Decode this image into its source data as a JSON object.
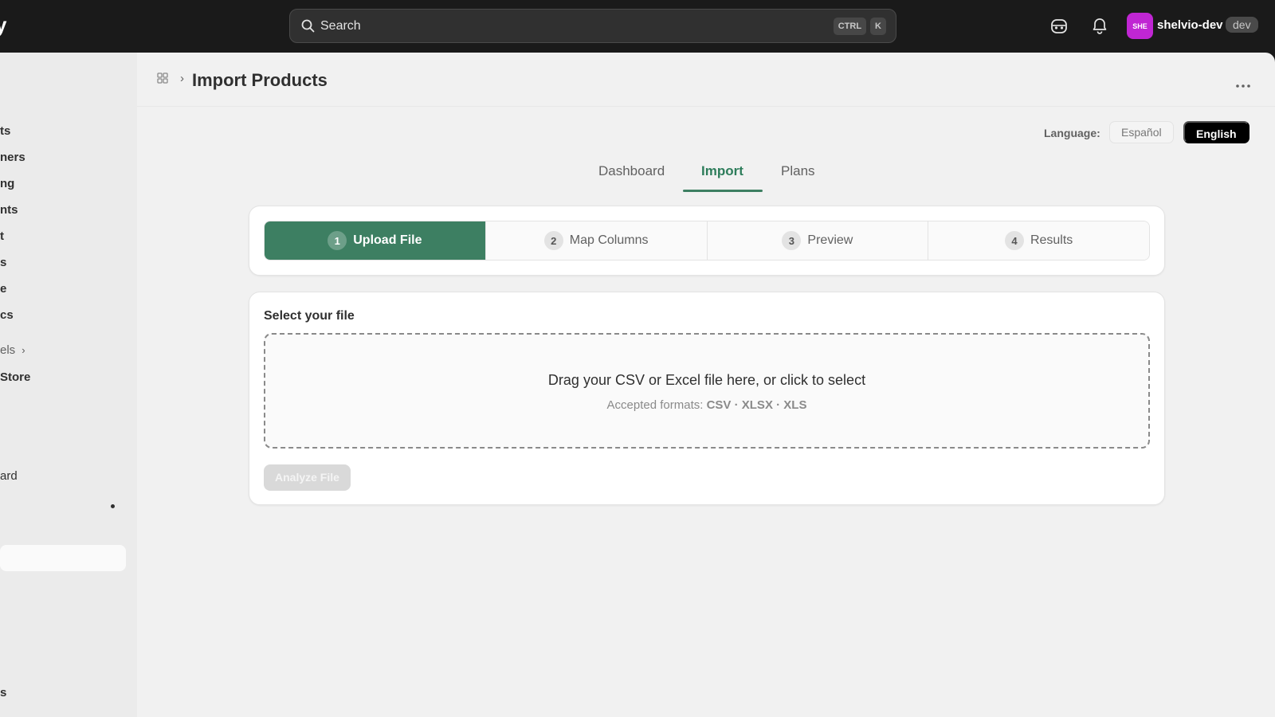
{
  "topbar": {
    "brand": "y",
    "search_placeholder": "Search",
    "kbd1": "CTRL",
    "kbd2": "K",
    "avatar_initials": "SHE",
    "store_name": "shelvio-dev",
    "store_badge": "dev"
  },
  "sidebar": {
    "items": [
      "ts",
      "ners",
      "ng",
      "nts",
      "t",
      "s",
      "e",
      "cs"
    ],
    "channels_label": "els",
    "store_label": "Store",
    "app_items": [
      "ard"
    ],
    "bottom_item": "s"
  },
  "header": {
    "title": "Import Products"
  },
  "language": {
    "label": "Language:",
    "option_es": "Español",
    "option_en": "English",
    "selected": "English"
  },
  "tabs": [
    {
      "label": "Dashboard"
    },
    {
      "label": "Import"
    },
    {
      "label": "Plans"
    }
  ],
  "steps": [
    {
      "num": "1",
      "label": "Upload File"
    },
    {
      "num": "2",
      "label": "Map Columns"
    },
    {
      "num": "3",
      "label": "Preview"
    },
    {
      "num": "4",
      "label": "Results"
    }
  ],
  "upload": {
    "label": "Select your file",
    "dropzone_title": "Drag your CSV or Excel file here, or click to select",
    "formats_prefix": "Accepted formats:",
    "formats": "CSV · XLSX · XLS",
    "analyze_button": "Analyze File"
  },
  "colors": {
    "accent": "#3d7f62",
    "topbar": "#1a1a1a",
    "avatar": "#c026d3"
  }
}
